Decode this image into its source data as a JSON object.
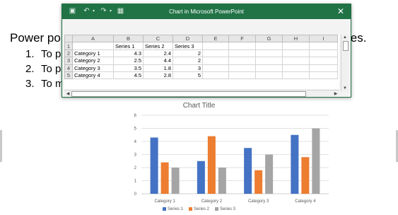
{
  "slide": {
    "title_visible": "Power po",
    "title_tail": "ies.",
    "bullets": [
      {
        "num": "1.",
        "text": "To p"
      },
      {
        "num": "2.",
        "text": "To p"
      },
      {
        "num": "3.",
        "text": "To m"
      }
    ]
  },
  "excel": {
    "title": "Chart in Microsoft PowerPoint",
    "icons": [
      "save-icon",
      "undo-icon",
      "redo-icon",
      "edit-data-icon",
      "close-icon"
    ],
    "columns": [
      "A",
      "B",
      "C",
      "D",
      "E",
      "F",
      "G",
      "H",
      "I"
    ],
    "rows": [
      {
        "n": "1",
        "cells": [
          "",
          "Series 1",
          "Series 2",
          "Series 3",
          "",
          "",
          "",
          "",
          ""
        ]
      },
      {
        "n": "2",
        "cells": [
          "Category 1",
          "4.3",
          "2.4",
          "2",
          "",
          "",
          "",
          "",
          ""
        ]
      },
      {
        "n": "3",
        "cells": [
          "Category 2",
          "2.5",
          "4.4",
          "2",
          "",
          "",
          "",
          "",
          ""
        ]
      },
      {
        "n": "4",
        "cells": [
          "Category 3",
          "3.5",
          "1.8",
          "3",
          "",
          "",
          "",
          "",
          ""
        ]
      },
      {
        "n": "5",
        "cells": [
          "Category 4",
          "4.5",
          "2.8",
          "5",
          "",
          "",
          "",
          "",
          ""
        ]
      }
    ]
  },
  "chart_data": {
    "type": "bar",
    "title": "Chart Title",
    "categories": [
      "Category 1",
      "Category 2",
      "Category 3",
      "Category 4"
    ],
    "series": [
      {
        "name": "Series 1",
        "values": [
          4.3,
          2.5,
          3.5,
          4.5
        ],
        "color": "#4472c4"
      },
      {
        "name": "Series 2",
        "values": [
          2.4,
          4.4,
          1.8,
          2.8
        ],
        "color": "#ed7d31"
      },
      {
        "name": "Series 3",
        "values": [
          2,
          2,
          3,
          5
        ],
        "color": "#a5a5a5"
      }
    ],
    "ylim": [
      0,
      6
    ],
    "yticks": [
      "0",
      "1",
      "2",
      "3",
      "4",
      "5",
      "6"
    ],
    "grid": true,
    "legend": "bottom"
  }
}
